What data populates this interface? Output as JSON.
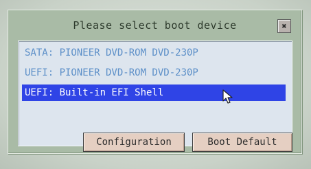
{
  "dialog": {
    "title": "Please select boot device",
    "close_label": "✖"
  },
  "boot_devices": [
    "SATA: PIONEER DVD-ROM DVD-230P",
    "UEFI: PIONEER DVD-ROM DVD-230P",
    "UEFI: Built-in EFI Shell"
  ],
  "selected_index": 2,
  "buttons": {
    "configuration": "Configuration",
    "boot_default": "Boot Default"
  },
  "colors": {
    "selection": "#2f44e6",
    "item_text": "#5c8fc8",
    "dialog_bg": "#a9bba6",
    "list_bg": "#dde5ee",
    "button_bg": "#e5cfc2"
  }
}
